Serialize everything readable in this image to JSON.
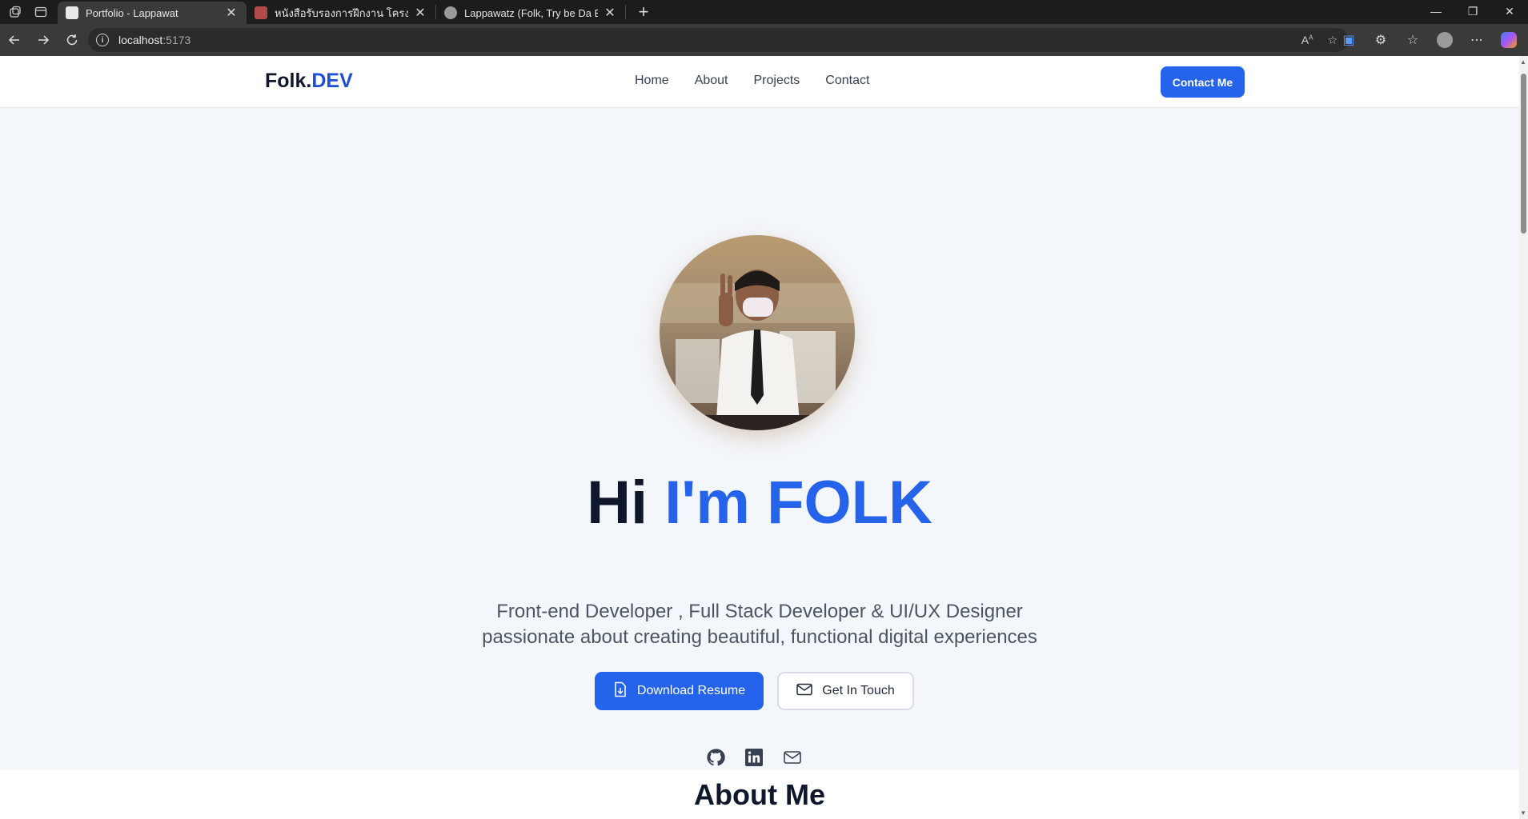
{
  "browser": {
    "tabs": [
      {
        "title": "Portfolio - Lappawat",
        "active": true
      },
      {
        "title": "หนังสือรับรองการฝึกงาน โครงการ SCG",
        "active": false
      },
      {
        "title": "Lappawatz (Folk, Try be Da Best)",
        "active": false
      }
    ],
    "url_host": "localhost",
    "url_port": ":5173"
  },
  "site": {
    "logo_main": "Folk.",
    "logo_accent": "DEV",
    "nav": [
      "Home",
      "About",
      "Projects",
      "Contact"
    ],
    "contact_button": "Contact Me"
  },
  "hero": {
    "greeting": "Hi ",
    "name": "I'm FOLK",
    "subtitle_line1": "Front-end Developer , Full Stack Developer & UI/UX Designer",
    "subtitle_line2": "passionate about creating beautiful, functional digital experiences",
    "download_button": "Download Resume",
    "touch_button": "Get In Touch",
    "socials": [
      "github-icon",
      "linkedin-icon",
      "mail-icon"
    ]
  },
  "about": {
    "title": "About Me"
  },
  "colors": {
    "accent": "#2563eb",
    "dark": "#0f172a",
    "hero_bg": "#f3f6fa"
  }
}
